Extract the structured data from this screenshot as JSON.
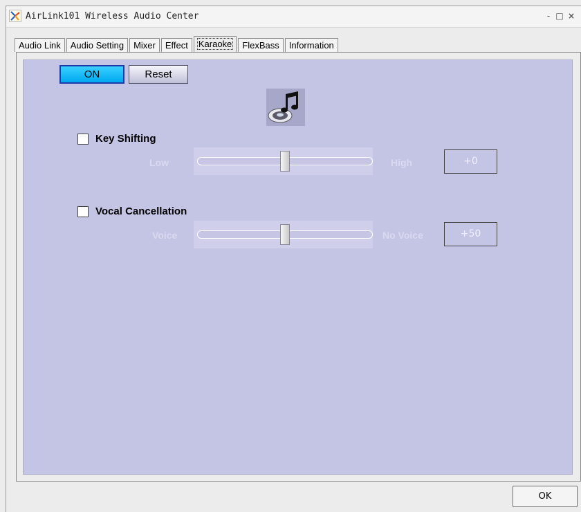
{
  "window": {
    "title": "AirLink101 Wireless Audio Center",
    "minimize_label": "-",
    "maximize_label": "□",
    "close_label": "×"
  },
  "tabs": [
    {
      "label": "Audio Link",
      "active": false
    },
    {
      "label": "Audio Setting",
      "active": false
    },
    {
      "label": "Mixer",
      "active": false
    },
    {
      "label": "Effect",
      "active": false
    },
    {
      "label": "Karaoke",
      "active": true
    },
    {
      "label": "FlexBass",
      "active": false
    },
    {
      "label": "Information",
      "active": false
    }
  ],
  "karaoke": {
    "on_label": "ON",
    "reset_label": "Reset",
    "key_shifting": {
      "label": "Key Shifting",
      "checked": false,
      "min_label": "Low",
      "max_label": "High",
      "value": "+0",
      "level_percent": 50
    },
    "vocal_cancellation": {
      "label": "Vocal Cancellation",
      "checked": false,
      "min_label": "Voice",
      "max_label": "No Voice",
      "value": "+50",
      "level_percent": 50
    }
  },
  "footer": {
    "ok_label": "OK"
  },
  "colors": {
    "panel_background": "#c4c4e4",
    "on_button": "#00a7ef",
    "disabled_text": "#d9d9ef"
  },
  "icons": {
    "app": "airlink-app-icon",
    "karaoke": "music-cd-icon"
  }
}
